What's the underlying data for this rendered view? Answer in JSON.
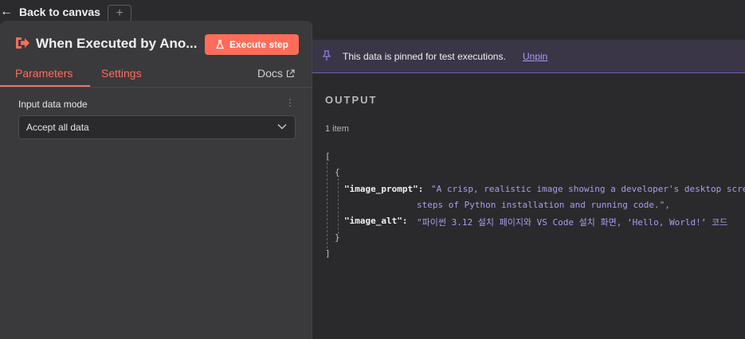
{
  "topbar": {
    "back_label": "Back to canvas",
    "add_tab": "+"
  },
  "node": {
    "title": "When Executed by Ano...",
    "execute_label": "Execute step",
    "tabs": {
      "parameters": "Parameters",
      "settings": "Settings",
      "docs": "Docs"
    }
  },
  "params": {
    "input_mode_label": "Input data mode",
    "input_mode_value": "Accept all data",
    "menu_glyph": "⋮"
  },
  "output": {
    "pinned_text": "This data is pinned for test executions.",
    "unpin_label": "Unpin",
    "title": "OUTPUT",
    "item_count": "1 item",
    "json": {
      "open_bracket": "[",
      "open_brace": "{",
      "key1": "\"image_prompt\":",
      "val1_line1": "\"A crisp, realistic image showing a developer's desktop scre",
      "val1_line2": "steps of Python installation and running code.\",",
      "key2": "\"image_alt\":",
      "val2": "\"파이썬 3.12 설치 페이지와 VS Code 설치 화면, ‘Hello, World!’ 코드",
      "close_brace": "}",
      "close_bracket": "]"
    }
  },
  "colors": {
    "accent": "#ff6d5a",
    "pin": "#a99cf0",
    "banner": "#3b3548"
  }
}
